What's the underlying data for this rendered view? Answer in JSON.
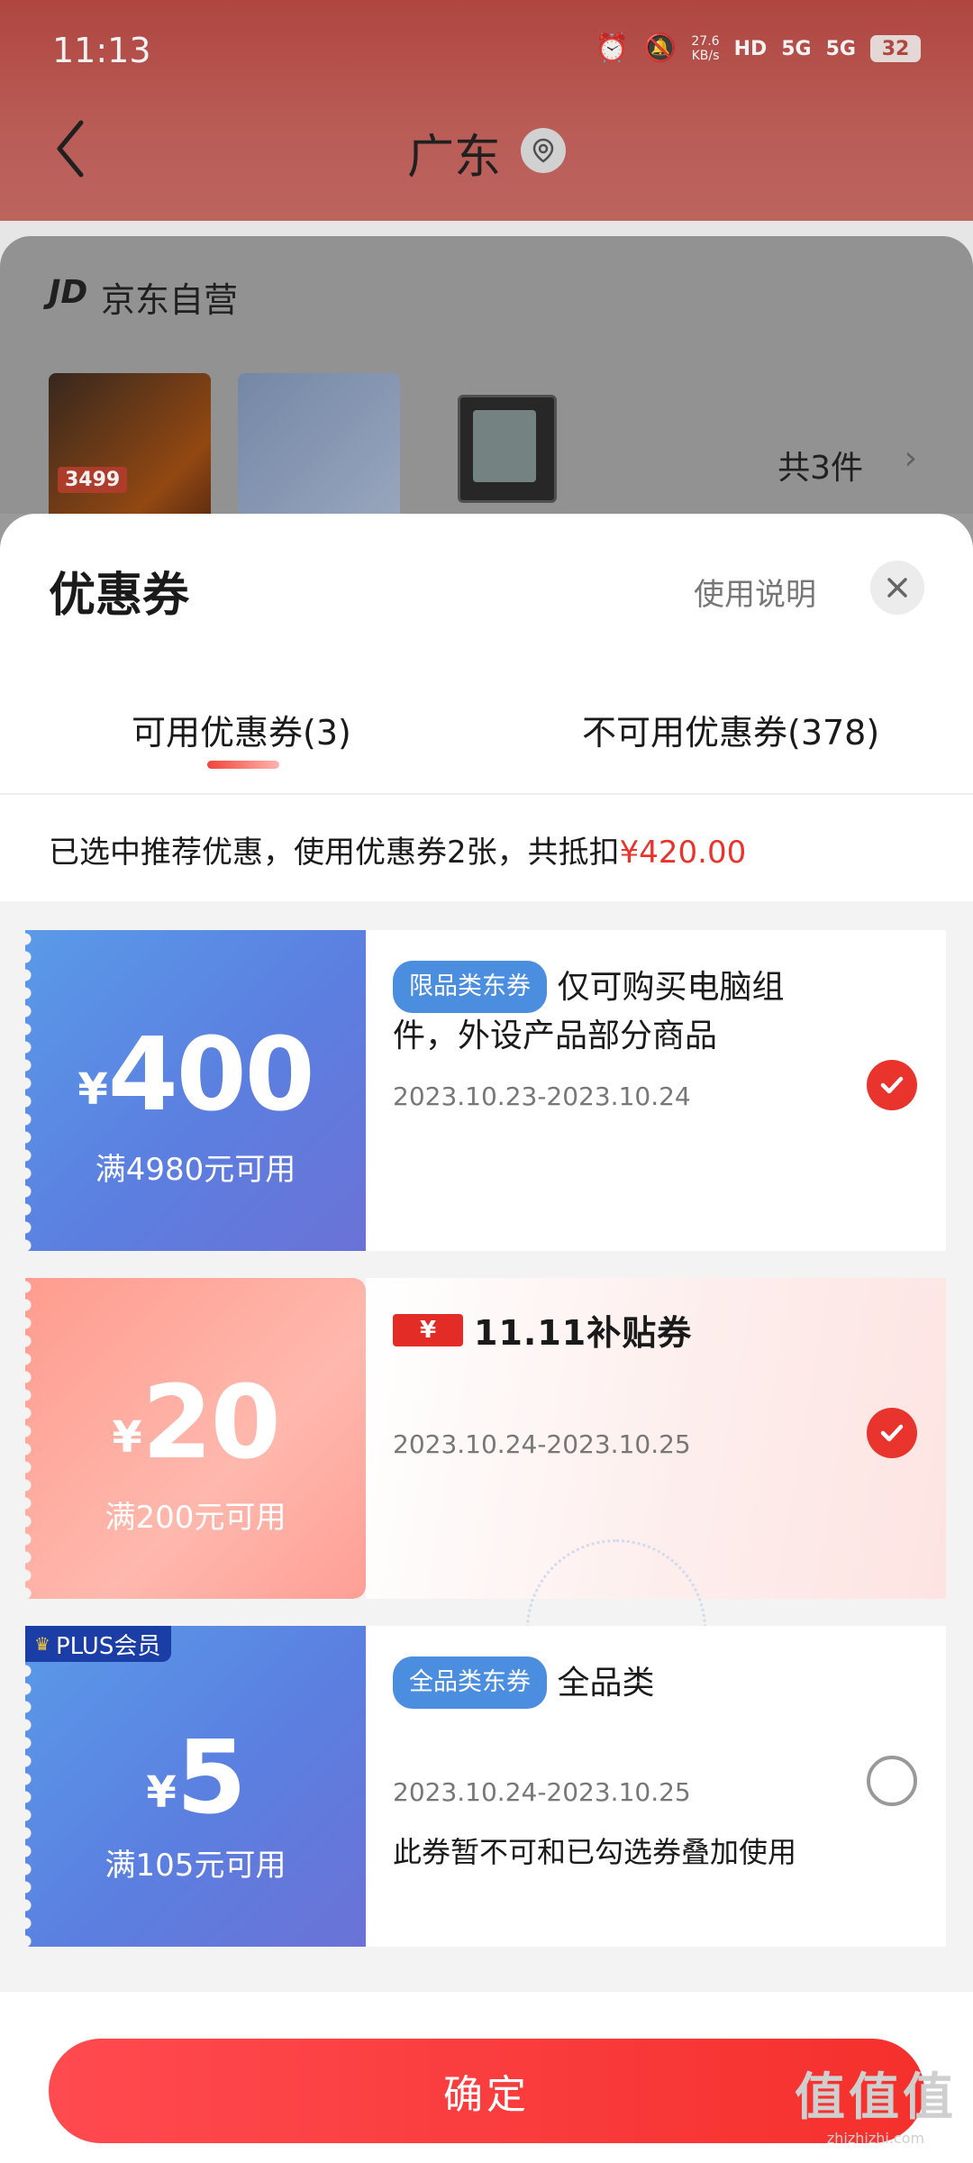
{
  "status_bar": {
    "time": "11:13",
    "net_speed_value": "27.6",
    "net_speed_unit": "KB/s",
    "hd_label": "HD",
    "signal_1": "5G",
    "signal_2": "5G",
    "battery": "32"
  },
  "header": {
    "title": "广东"
  },
  "shop": {
    "logo": "JD",
    "name": "京东自营",
    "thumb_price": "3499",
    "item_count": "共3件"
  },
  "sheet": {
    "title": "优惠券",
    "help_label": "使用说明",
    "tabs": [
      {
        "label": "可用优惠券(3)"
      },
      {
        "label": "不可用优惠券(378)"
      }
    ],
    "summary_text": "已选中推荐优惠，使用优惠券2张，共抵扣",
    "summary_amount": "¥420.00"
  },
  "coupons": [
    {
      "currency": "¥",
      "amount": "400",
      "condition": "满4980元可用",
      "tag": "限品类东券",
      "description": "仅可购买电脑组件，外设产品部分商品",
      "date": "2023.10.23-2023.10.24",
      "selected": true
    },
    {
      "currency": "¥",
      "amount": "20",
      "condition": "满200元可用",
      "badge_icon": "¥",
      "badge_text": "11.11补贴券",
      "date": "2023.10.24-2023.10.25",
      "selected": true
    },
    {
      "currency": "¥",
      "amount": "5",
      "condition": "满105元可用",
      "plus_badge": "PLUS会员",
      "tag": "全品类东券",
      "description": "全品类",
      "date": "2023.10.24-2023.10.25",
      "note": "此券暂不可和已勾选券叠加使用",
      "selected": false
    }
  ],
  "footer": {
    "confirm_label": "确定",
    "watermark_glyphs": "值值值",
    "watermark_url": "zhizhizhi.com"
  },
  "colors": {
    "accent_red": "#e8342c",
    "coupon_blue": "#5b7fe0",
    "coupon_pink": "#ffb0a6",
    "tag_blue": "#4b8ee0"
  },
  "icons": [
    "back-icon",
    "location-icon",
    "alarm-icon",
    "mute-icon",
    "close-icon",
    "check-icon",
    "chevron-right-icon",
    "crown-icon"
  ]
}
